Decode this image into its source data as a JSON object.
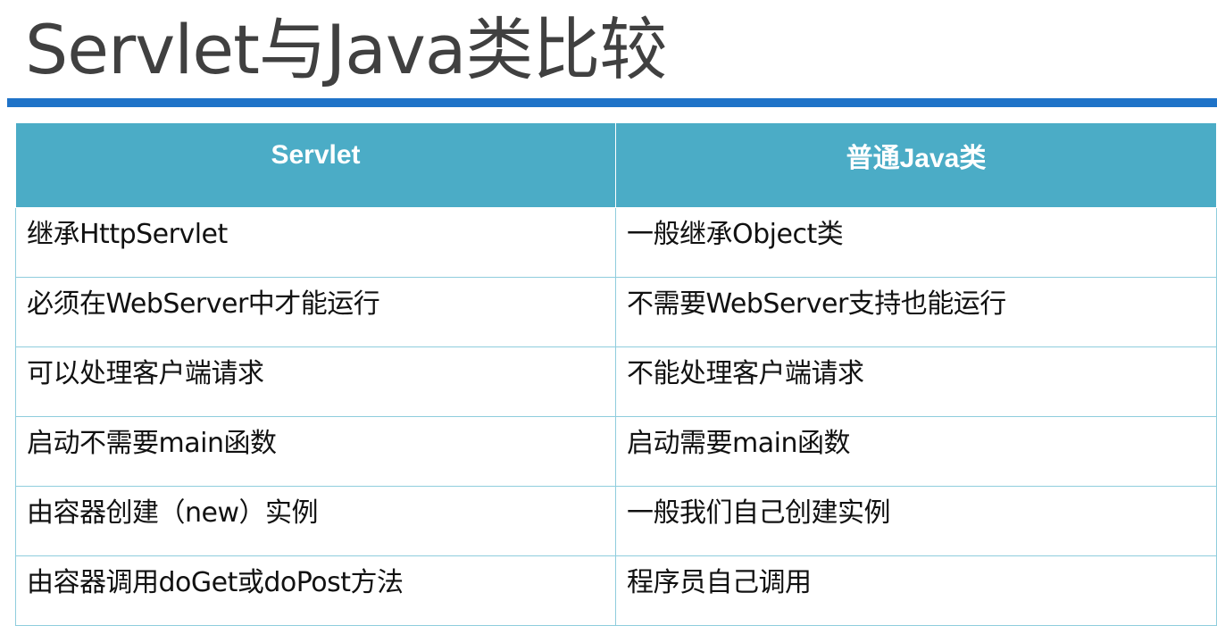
{
  "title": "Servlet与Java类比较",
  "table": {
    "headers": [
      "Servlet",
      "普通Java类"
    ],
    "rows": [
      [
        "继承HttpServlet",
        "一般继承Object类"
      ],
      [
        "必须在WebServer中才能运行",
        "不需要WebServer支持也能运行"
      ],
      [
        "可以处理客户端请求",
        "不能处理客户端请求"
      ],
      [
        "启动不需要main函数",
        "启动需要main函数"
      ],
      [
        "由容器创建（new）实例",
        "一般我们自己创建实例"
      ],
      [
        "由容器调用doGet或doPost方法",
        "程序员自己调用"
      ]
    ]
  },
  "colors": {
    "title_text": "#404040",
    "title_rule": "#1f73c8",
    "header_bg": "#4bacc6",
    "cell_border": "#8fcddd"
  }
}
